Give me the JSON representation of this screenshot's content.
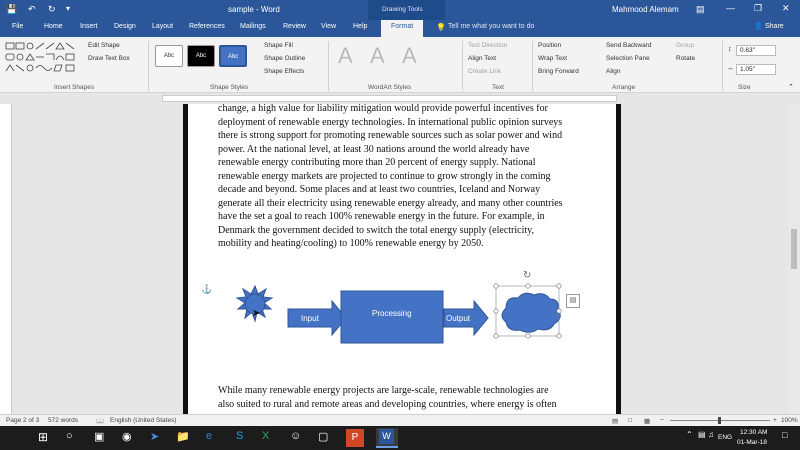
{
  "titlebar": {
    "doc_title": "sample  -  Word",
    "context_label": "Drawing Tools",
    "user": "Mahmood Alemam"
  },
  "tabs": [
    "File",
    "Home",
    "Insert",
    "Design",
    "Layout",
    "References",
    "Mailings",
    "Review",
    "View",
    "Help",
    "Format"
  ],
  "tell_me": "Tell me what you want to do",
  "share": "Share",
  "ribbon": {
    "insert_shapes": {
      "edit_shape": "Edit Shape",
      "draw_text_box": "Draw Text Box",
      "group": "Insert Shapes"
    },
    "shape_styles": {
      "swatches": [
        "Abc",
        "Abc",
        "Abc"
      ],
      "fill": "Shape Fill",
      "outline": "Shape Outline",
      "effects": "Shape Effects",
      "group": "Shape Styles"
    },
    "wordart": {
      "letters": [
        "A",
        "A",
        "A"
      ],
      "group": "WordArt Styles"
    },
    "text": {
      "direction": "Text Direction",
      "align": "Align Text",
      "link": "Create Link",
      "group": "Text"
    },
    "arrange": {
      "position": "Position",
      "wrap": "Wrap Text",
      "bring_forward": "Bring Forward",
      "send_backward": "Send Backward",
      "selection_pane": "Selection Pane",
      "align": "Align",
      "group_btn": "Group",
      "rotate": "Rotate",
      "group": "Arrange"
    },
    "size": {
      "height": "0.63\"",
      "width": "1.05\"",
      "group": "Size"
    }
  },
  "document": {
    "para1_lines": [
      "change, a high value for liability mitigation would provide powerful incentives for",
      "deployment of renewable energy technologies. In international public opinion surveys",
      "there is strong support for promoting renewable sources such as solar power and wind",
      "power. At the national level, at least 30 nations around the world already have",
      "renewable energy contributing more than 20 percent of energy supply. National",
      "renewable energy markets are projected to continue to grow strongly in the coming",
      "decade and beyond. Some places and at least two countries, Iceland and Norway",
      "generate all their electricity using renewable energy already, and many other countries",
      "have the set a goal to reach 100% renewable energy in the future. For example, in",
      "Denmark the government decided to switch the total energy supply (electricity,",
      "mobility and heating/cooling) to 100% renewable energy by 2050."
    ],
    "diagram": {
      "input": "Input",
      "processing": "Processing",
      "output": "Output"
    },
    "para2_lines": [
      "While many renewable energy projects are large-scale, renewable technologies are",
      "also suited to rural and remote areas and developing countries, where energy is often"
    ]
  },
  "statusbar": {
    "page": "Page 2 of 3",
    "words": "572 words",
    "language": "English (United States)",
    "zoom": "100%"
  },
  "taskbar": {
    "lang": "ENG",
    "time": "12:30 AM",
    "date": "01-Mar-18"
  },
  "colors": {
    "word_blue": "#2b579a",
    "shape_blue": "#4472c4",
    "shape_border": "#2f5597"
  }
}
